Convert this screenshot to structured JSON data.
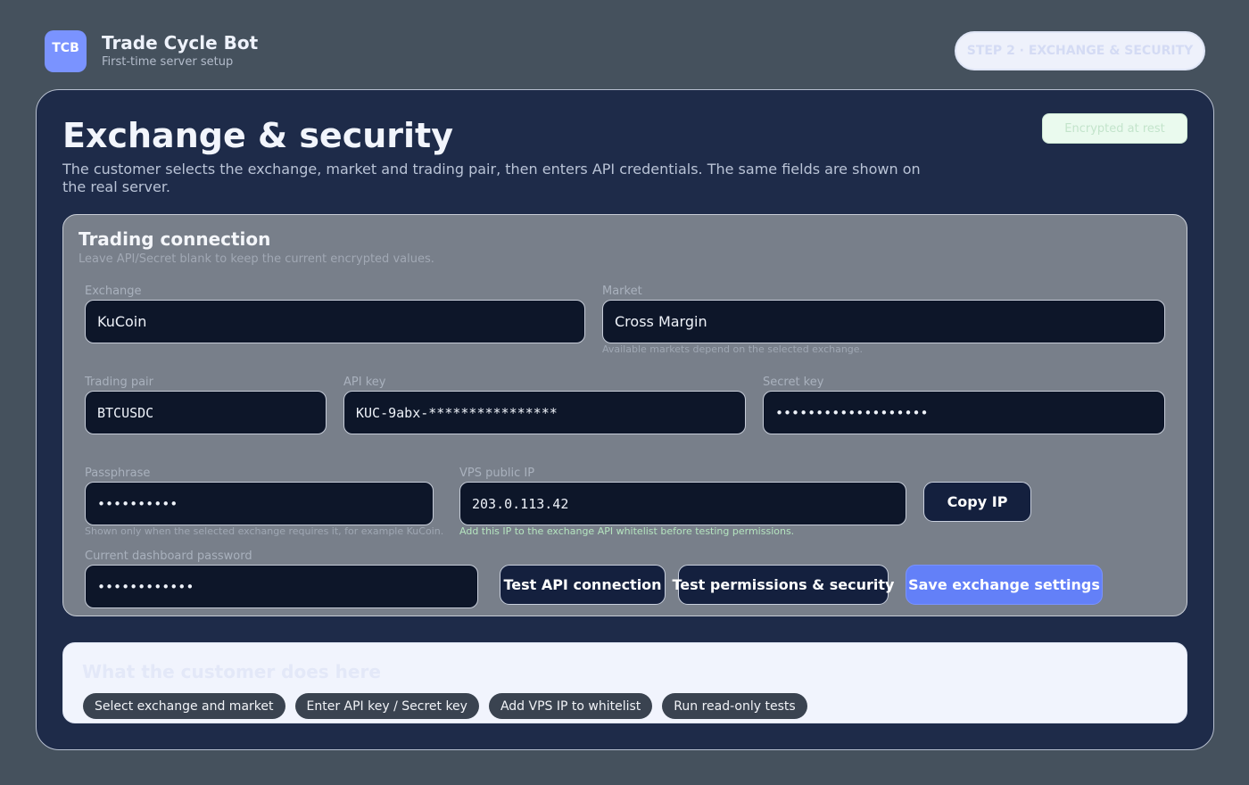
{
  "app": {
    "logo_text": "TCB",
    "title": "Trade Cycle Bot",
    "subtitle": "First-time server setup",
    "step_badge": "STEP 2 · EXCHANGE & SECURITY"
  },
  "page": {
    "title": "Exchange & security",
    "description": "The customer selects the exchange, market and trading pair, then enters API credentials. The same fields are shown on the real server.",
    "encrypted_badge": "Encrypted at rest"
  },
  "connection": {
    "title": "Trading connection",
    "subtitle": "Leave API/Secret blank to keep the current encrypted values.",
    "exchange": {
      "label": "Exchange",
      "value": "KuCoin"
    },
    "market": {
      "label": "Market",
      "value": "Cross Margin",
      "hint": "Available markets depend on the selected exchange."
    },
    "trading_pair": {
      "label": "Trading pair",
      "value": "BTCUSDC"
    },
    "api_key": {
      "label": "API key",
      "value": "KUC-9abx-****************"
    },
    "secret_key": {
      "label": "Secret key",
      "value": "•••••••••••••••••••"
    },
    "passphrase": {
      "label": "Passphrase",
      "value": "••••••••••",
      "hint": "Shown only when the selected exchange requires it, for example KuCoin."
    },
    "vps_ip": {
      "label": "VPS public IP",
      "value": "203.0.113.42",
      "hint": "Add this IP to the exchange API whitelist before testing permissions."
    },
    "copy_ip_label": "Copy IP",
    "dashboard_password": {
      "label": "Current dashboard password",
      "value": "••••••••••••"
    },
    "test_api_label": "Test API connection",
    "test_permissions_label": "Test permissions & security",
    "save_label": "Save exchange settings"
  },
  "help": {
    "title": "What the customer does here",
    "steps": [
      "Select exchange and market",
      "Enter API key / Secret key",
      "Add VPS IP to whitelist",
      "Run read-only tests"
    ]
  },
  "colors": {
    "background": "#45515d",
    "card": "#1e2b49",
    "panel": "#787f8a",
    "input": "#0d1629",
    "accent": "#6380f8",
    "logo": "#7a93ff"
  }
}
